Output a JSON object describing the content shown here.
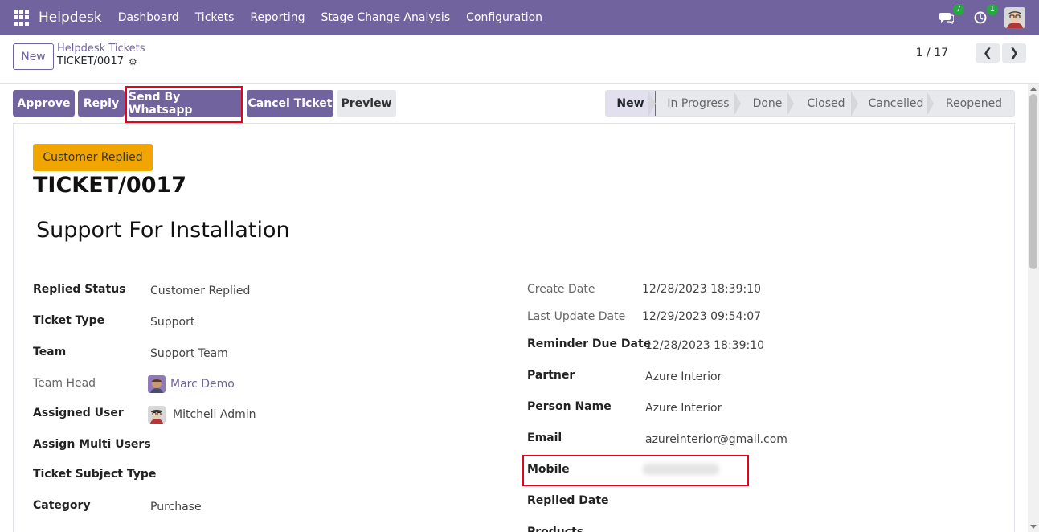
{
  "nav": {
    "app_name": "Helpdesk",
    "items": [
      "Dashboard",
      "Tickets",
      "Reporting",
      "Stage Change Analysis",
      "Configuration"
    ],
    "messages_count": "7",
    "activities_count": "1"
  },
  "control_panel": {
    "new_label": "New",
    "breadcrumb_parent": "Helpdesk Tickets",
    "breadcrumb_current": "TICKET/0017",
    "pager": "1 / 17"
  },
  "actions": {
    "approve": "Approve",
    "reply": "Reply",
    "send_whatsapp": "Send By Whatsapp",
    "cancel_ticket": "Cancel Ticket",
    "preview": "Preview"
  },
  "stages": [
    "New",
    "In Progress",
    "Done",
    "Closed",
    "Cancelled",
    "Reopened"
  ],
  "active_stage": "New",
  "form": {
    "ribbon": "Customer Replied",
    "ticket_number": "TICKET/0017",
    "subject": "Support For Installation",
    "left": [
      {
        "label": "Replied Status",
        "value": "Customer Replied"
      },
      {
        "label": "Ticket Type",
        "value": "Support"
      },
      {
        "label": "Team",
        "value": "Support Team"
      },
      {
        "label": "Team Head",
        "value": "Marc Demo"
      },
      {
        "label": "Assigned User",
        "value": "Mitchell Admin"
      },
      {
        "label": "Assign Multi Users",
        "value": ""
      },
      {
        "label": "Ticket Subject Type",
        "value": ""
      },
      {
        "label": "Category",
        "value": "Purchase"
      }
    ],
    "right": [
      {
        "label": "Create Date",
        "value": "12/28/2023 18:39:10"
      },
      {
        "label": "Last Update Date",
        "value": "12/29/2023 09:54:07"
      },
      {
        "label": "Reminder Due Date",
        "value": "12/28/2023 18:39:10"
      },
      {
        "label": "Partner",
        "value": "Azure Interior"
      },
      {
        "label": "Person Name",
        "value": "Azure Interior"
      },
      {
        "label": "Email",
        "value": "azureinterior@gmail.com"
      },
      {
        "label": "Mobile",
        "value": ""
      },
      {
        "label": "Replied Date",
        "value": ""
      },
      {
        "label": "Products",
        "value": ""
      }
    ]
  },
  "colors": {
    "brand": "#71639e",
    "ribbon": "#f0a500",
    "highlight": "#e8001c"
  }
}
